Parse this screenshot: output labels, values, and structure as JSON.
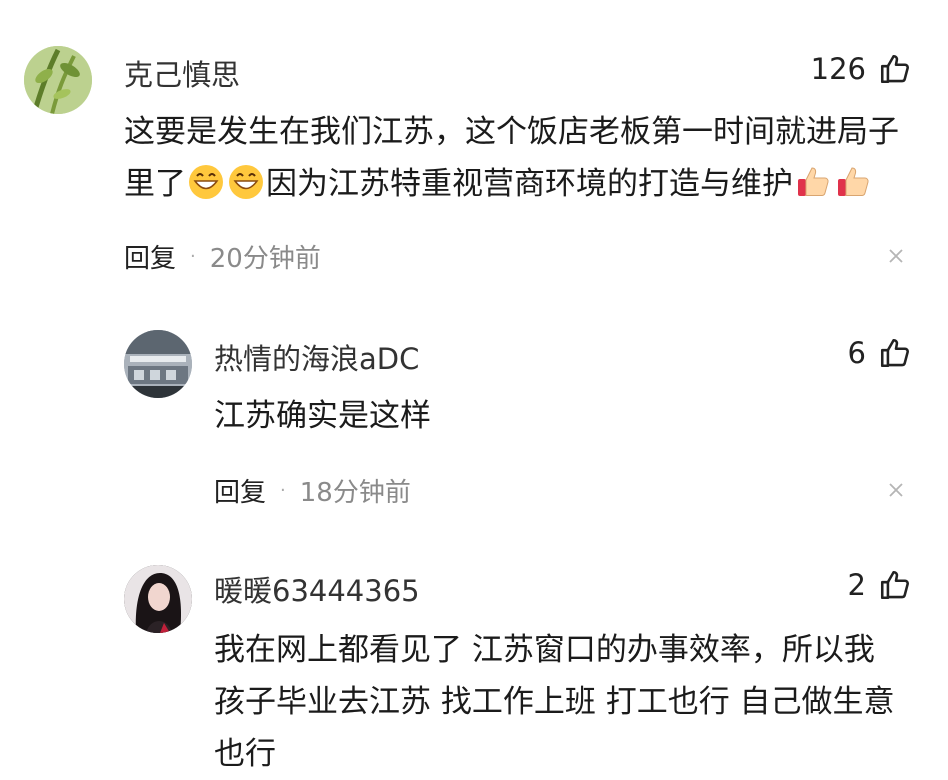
{
  "comments": [
    {
      "username": "克己慎思",
      "likes": "126",
      "text_line1": "这要是发生在我们江苏，这个饭店老板第一时间就进局子",
      "text_line2_a": "里了",
      "text_line2_b": "因为江苏特重视营商环境的打造与维护",
      "reply_label": "回复",
      "separator": "·",
      "time": "20分钟前"
    },
    {
      "username": "热情的海浪aDC",
      "likes": "6",
      "text": "江苏确实是这样",
      "reply_label": "回复",
      "separator": "·",
      "time": "18分钟前"
    },
    {
      "username": "暖暖63444365",
      "likes": "2",
      "text_line1": "我在网上都看见了 江苏窗口的办事效率，所以我",
      "text_line2": "孩子毕业去江苏 找工作上班 打工也行 自己做生意",
      "text_line3": "也行"
    }
  ],
  "icons": {
    "like": "thumbs-up-icon",
    "close": "close-icon",
    "laugh": "grinning-emoji",
    "thumb": "thumbs-up-emoji"
  }
}
